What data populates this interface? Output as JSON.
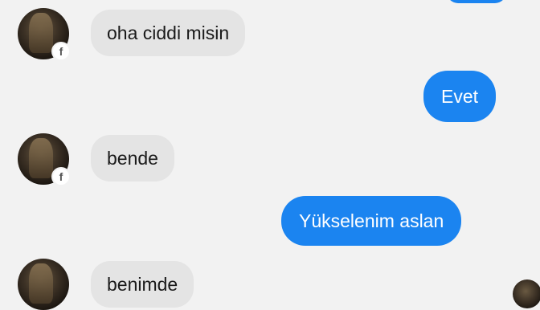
{
  "messages": [
    {
      "direction": "incoming",
      "text": "oha ciddi misin"
    },
    {
      "direction": "outgoing",
      "text": "Evet"
    },
    {
      "direction": "incoming",
      "text": "bende"
    },
    {
      "direction": "outgoing",
      "text": "Yükselenim aslan"
    },
    {
      "direction": "incoming",
      "text": "benimde"
    }
  ],
  "avatar_badge": "f",
  "colors": {
    "background": "#f2f2f2",
    "incoming_bubble": "#e4e4e4",
    "outgoing_bubble": "#1b84f0",
    "outgoing_text": "#ffffff"
  },
  "icons": {
    "avatar_badge": "facebook-icon"
  }
}
